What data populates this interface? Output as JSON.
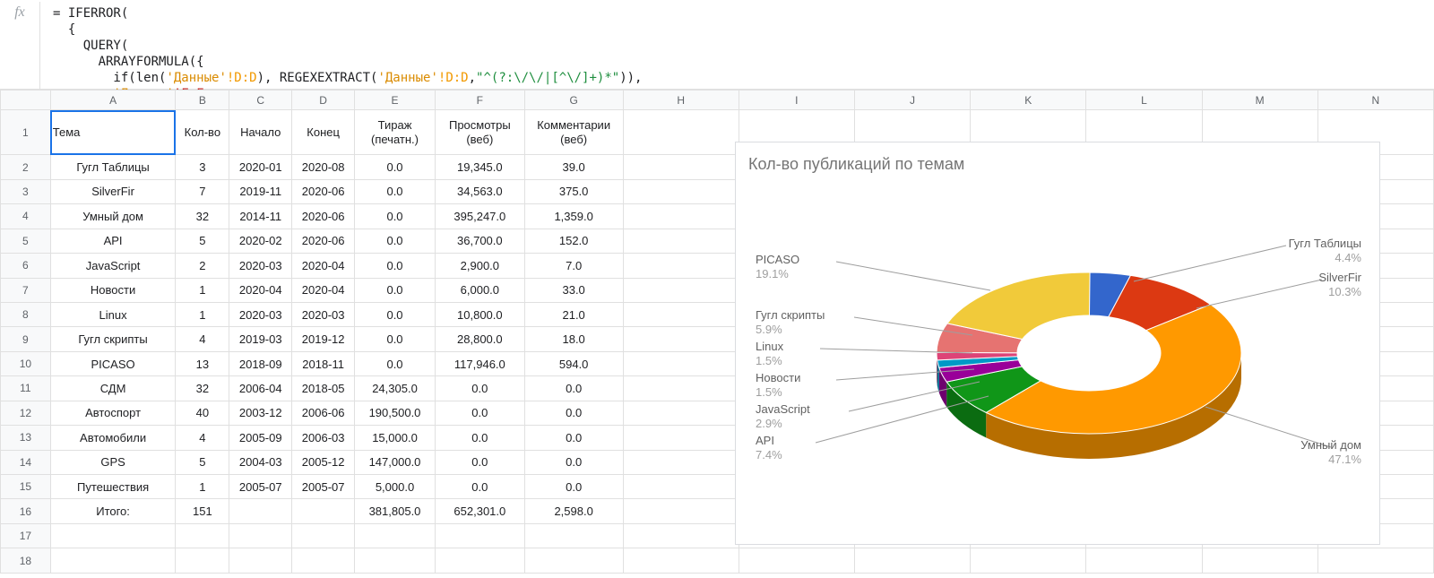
{
  "formula": {
    "line1": "= IFERROR(",
    "line2": "  {",
    "line3": "    QUERY(",
    "line4": "      ARRAYFORMULA({",
    "line5_pre": "        if(len(",
    "line5_rng1": "'Данные'",
    "line5_rng1b": "!D:D",
    "line5_mid": "), REGEXEXTRACT(",
    "line5_rng2": "'Данные'",
    "line5_rng2b": "!D:D",
    "line5_comma": ",",
    "line5_regex": "\"^(?:\\/\\/|[^\\/]+)*\"",
    "line5_end": ")),",
    "line6_pre": "        ",
    "line6_rng": "'Данные'",
    "line6_rngb": "!F:F",
    "line6_end": ","
  },
  "columns": [
    "A",
    "B",
    "C",
    "D",
    "E",
    "F",
    "G",
    "H",
    "I",
    "J",
    "K",
    "L",
    "M",
    "N"
  ],
  "headers": {
    "a": "Тема",
    "b": "Кол-во",
    "c": "Начало",
    "d": "Конец",
    "e1": "Тираж",
    "e2": "(печатн.)",
    "f1": "Просмотры",
    "f2": "(веб)",
    "g1": "Комментарии",
    "g2": "(веб)"
  },
  "rows": [
    {
      "a": "Гугл Таблицы",
      "b": "3",
      "c": "2020-01",
      "d": "2020-08",
      "e": "0.0",
      "f": "19,345.0",
      "g": "39.0"
    },
    {
      "a": "SilverFir",
      "b": "7",
      "c": "2019-11",
      "d": "2020-06",
      "e": "0.0",
      "f": "34,563.0",
      "g": "375.0"
    },
    {
      "a": "Умный дом",
      "b": "32",
      "c": "2014-11",
      "d": "2020-06",
      "e": "0.0",
      "f": "395,247.0",
      "g": "1,359.0"
    },
    {
      "a": "API",
      "b": "5",
      "c": "2020-02",
      "d": "2020-06",
      "e": "0.0",
      "f": "36,700.0",
      "g": "152.0"
    },
    {
      "a": "JavaScript",
      "b": "2",
      "c": "2020-03",
      "d": "2020-04",
      "e": "0.0",
      "f": "2,900.0",
      "g": "7.0"
    },
    {
      "a": "Новости",
      "b": "1",
      "c": "2020-04",
      "d": "2020-04",
      "e": "0.0",
      "f": "6,000.0",
      "g": "33.0"
    },
    {
      "a": "Linux",
      "b": "1",
      "c": "2020-03",
      "d": "2020-03",
      "e": "0.0",
      "f": "10,800.0",
      "g": "21.0"
    },
    {
      "a": "Гугл скрипты",
      "b": "4",
      "c": "2019-03",
      "d": "2019-12",
      "e": "0.0",
      "f": "28,800.0",
      "g": "18.0"
    },
    {
      "a": "PICASO",
      "b": "13",
      "c": "2018-09",
      "d": "2018-11",
      "e": "0.0",
      "f": "117,946.0",
      "g": "594.0"
    },
    {
      "a": "СДМ",
      "b": "32",
      "c": "2006-04",
      "d": "2018-05",
      "e": "24,305.0",
      "f": "0.0",
      "g": "0.0"
    },
    {
      "a": "Автоспорт",
      "b": "40",
      "c": "2003-12",
      "d": "2006-06",
      "e": "190,500.0",
      "f": "0.0",
      "g": "0.0"
    },
    {
      "a": "Автомобили",
      "b": "4",
      "c": "2005-09",
      "d": "2006-03",
      "e": "15,000.0",
      "f": "0.0",
      "g": "0.0"
    },
    {
      "a": "GPS",
      "b": "5",
      "c": "2004-03",
      "d": "2005-12",
      "e": "147,000.0",
      "f": "0.0",
      "g": "0.0"
    },
    {
      "a": "Путешествия",
      "b": "1",
      "c": "2005-07",
      "d": "2005-07",
      "e": "5,000.0",
      "f": "0.0",
      "g": "0.0"
    },
    {
      "a": "Итого:",
      "b": "151",
      "c": "",
      "d": "",
      "e": "381,805.0",
      "f": "652,301.0",
      "g": "2,598.0"
    }
  ],
  "chart_title": "Кол-во публикаций по темам",
  "chart_data": {
    "type": "pie",
    "title": "Кол-во публикаций по темам",
    "series": [
      {
        "name": "Гугл Таблицы",
        "pct": 4.4,
        "color": "#3366cc"
      },
      {
        "name": "SilverFir",
        "pct": 10.3,
        "color": "#dc3912"
      },
      {
        "name": "Умный дом",
        "pct": 47.1,
        "color": "#ff9900"
      },
      {
        "name": "API",
        "pct": 7.4,
        "color": "#109618"
      },
      {
        "name": "JavaScript",
        "pct": 2.9,
        "color": "#990099"
      },
      {
        "name": "Новости",
        "pct": 1.5,
        "color": "#0099c6"
      },
      {
        "name": "Linux",
        "pct": 1.5,
        "color": "#dd4477"
      },
      {
        "name": "Гугл скрипты",
        "pct": 5.9,
        "color": "#e67371"
      },
      {
        "name": "PICASO",
        "pct": 19.1,
        "color": "#f1ca3a"
      }
    ],
    "donut_hole": 0.5,
    "three_d": true
  },
  "labels": {
    "picaso": {
      "nm": "PICASO",
      "pc": "19.1%"
    },
    "gscripts": {
      "nm": "Гугл скрипты",
      "pc": "5.9%"
    },
    "linux": {
      "nm": "Linux",
      "pc": "1.5%"
    },
    "news": {
      "nm": "Новости",
      "pc": "1.5%"
    },
    "js": {
      "nm": "JavaScript",
      "pc": "2.9%"
    },
    "api": {
      "nm": "API",
      "pc": "7.4%"
    },
    "gtables": {
      "nm": "Гугл Таблицы",
      "pc": "4.4%"
    },
    "silverfir": {
      "nm": "SilverFir",
      "pc": "10.3%"
    },
    "smarthome": {
      "nm": "Умный дом",
      "pc": "47.1%"
    }
  }
}
